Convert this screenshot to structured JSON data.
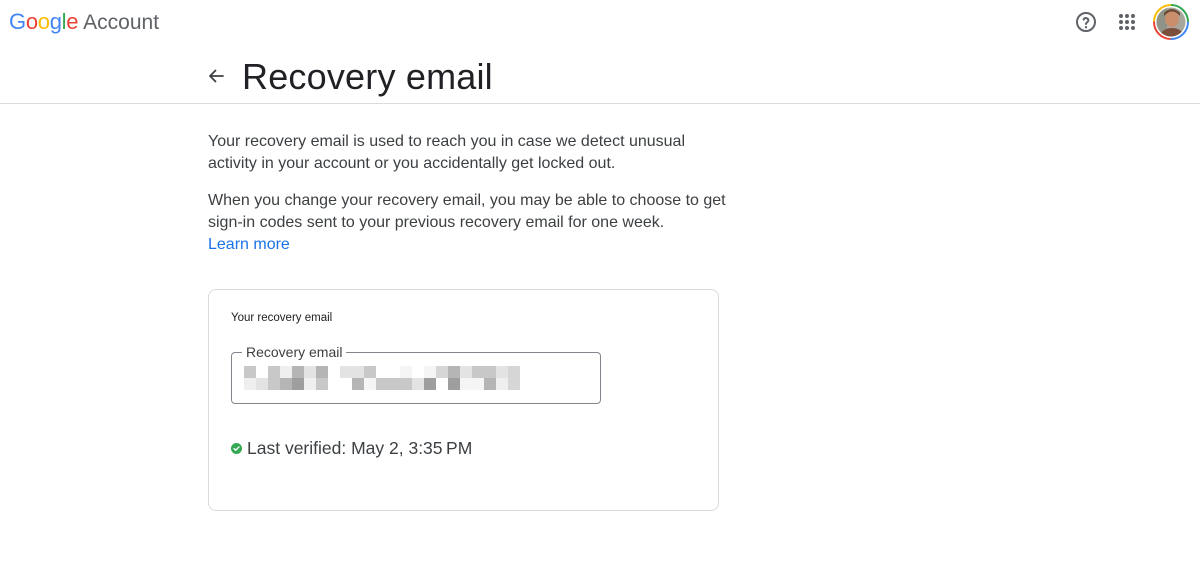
{
  "header": {
    "logo_text": "Google",
    "product_name": "Account",
    "logo_colors": [
      "#4285F4",
      "#EA4335",
      "#FBBC05",
      "#4285F4",
      "#34A853",
      "#EA4335"
    ],
    "help_icon": "help-circle-icon",
    "apps_icon": "apps-grid-icon",
    "avatar_icon": "user-avatar"
  },
  "page": {
    "back_icon": "arrow-left-icon",
    "title": "Recovery email"
  },
  "content": {
    "paragraph_1": "Your recovery email is used to reach you in case we detect unusual activity in your account or you accidentally get locked out.",
    "paragraph_2": "When you change your recovery email, you may be able to choose to get sign-in codes sent to your previous recovery email for one week.",
    "learn_more": "Learn more"
  },
  "card": {
    "label": "Your recovery email",
    "field_label": "Recovery email",
    "field_value_note": "pixelated",
    "verified_icon": "check-circle-icon",
    "verified_text": "Last verified: May 2, 3:35 PM"
  },
  "colors": {
    "link": "#1a73e8",
    "verified_green": "#34a853",
    "border": "#dadce0",
    "field_border": "#80868b"
  }
}
